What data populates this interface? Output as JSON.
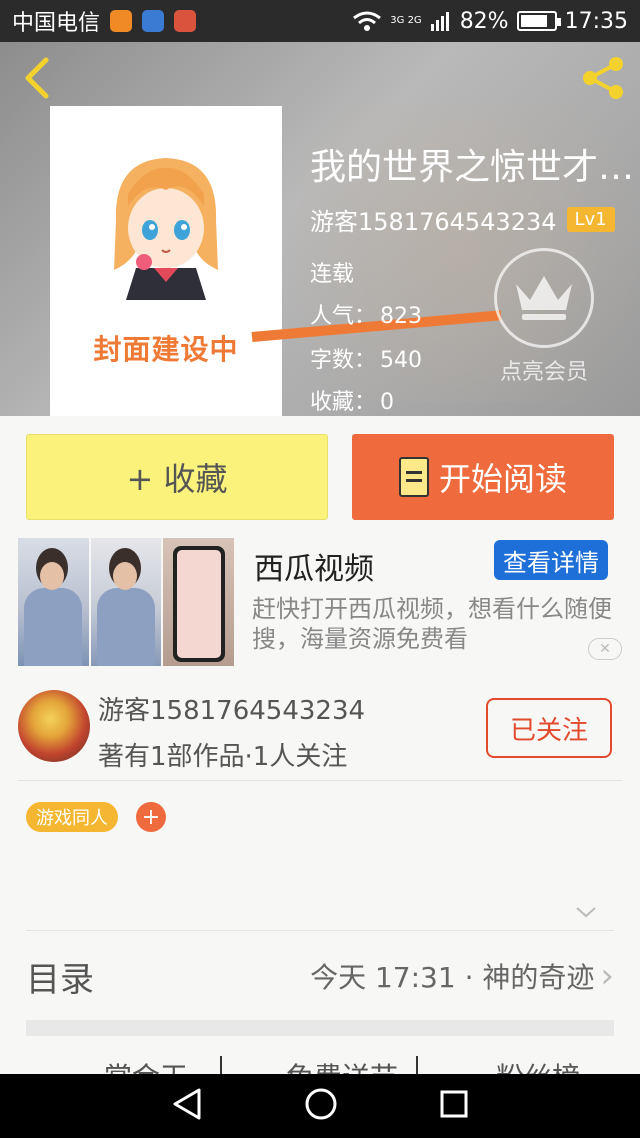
{
  "status_bar": {
    "carrier": "中国电信",
    "network": "3G 2G",
    "battery": "82%",
    "battery_level": 0.82,
    "time": "17:35"
  },
  "header": {
    "cover_text": "封面建设中",
    "title": "我的世界之惊世才…",
    "author": "游客1581764543234",
    "level": "Lv1",
    "status": "连载",
    "popularity_label": "人气：",
    "popularity_value": "823",
    "words_label": "字数：",
    "words_value": "540",
    "favorites_label": "收藏：",
    "favorites_value": "0",
    "vip_label": "点亮会员"
  },
  "actions": {
    "favorite_label": "+ 收藏",
    "read_label": "开始阅读"
  },
  "ad": {
    "title": "西瓜视频",
    "button": "查看详情",
    "description": "赶快打开西瓜视频，想看什么随便搜，海量资源免费看",
    "close": "✕"
  },
  "author_row": {
    "name": "游客1581764543234",
    "stats": "著有1部作品·1人关注",
    "follow_label": "已关注"
  },
  "tags": {
    "items": [
      "游戏同人"
    ],
    "add": "+"
  },
  "toc": {
    "label": "目录",
    "latest": "今天 17:31 · 神的奇迹",
    "chevron": "›"
  },
  "tab_strip": {
    "items": [
      "赏金天",
      "免费送节",
      "粉丝榜"
    ]
  },
  "colors": {
    "accent_orange": "#ef6a3c",
    "favorite_yellow": "#fbf27b",
    "level_badge": "#f5b731",
    "ad_button_blue": "#1e6fd8",
    "follow_red": "#e24a2e"
  }
}
